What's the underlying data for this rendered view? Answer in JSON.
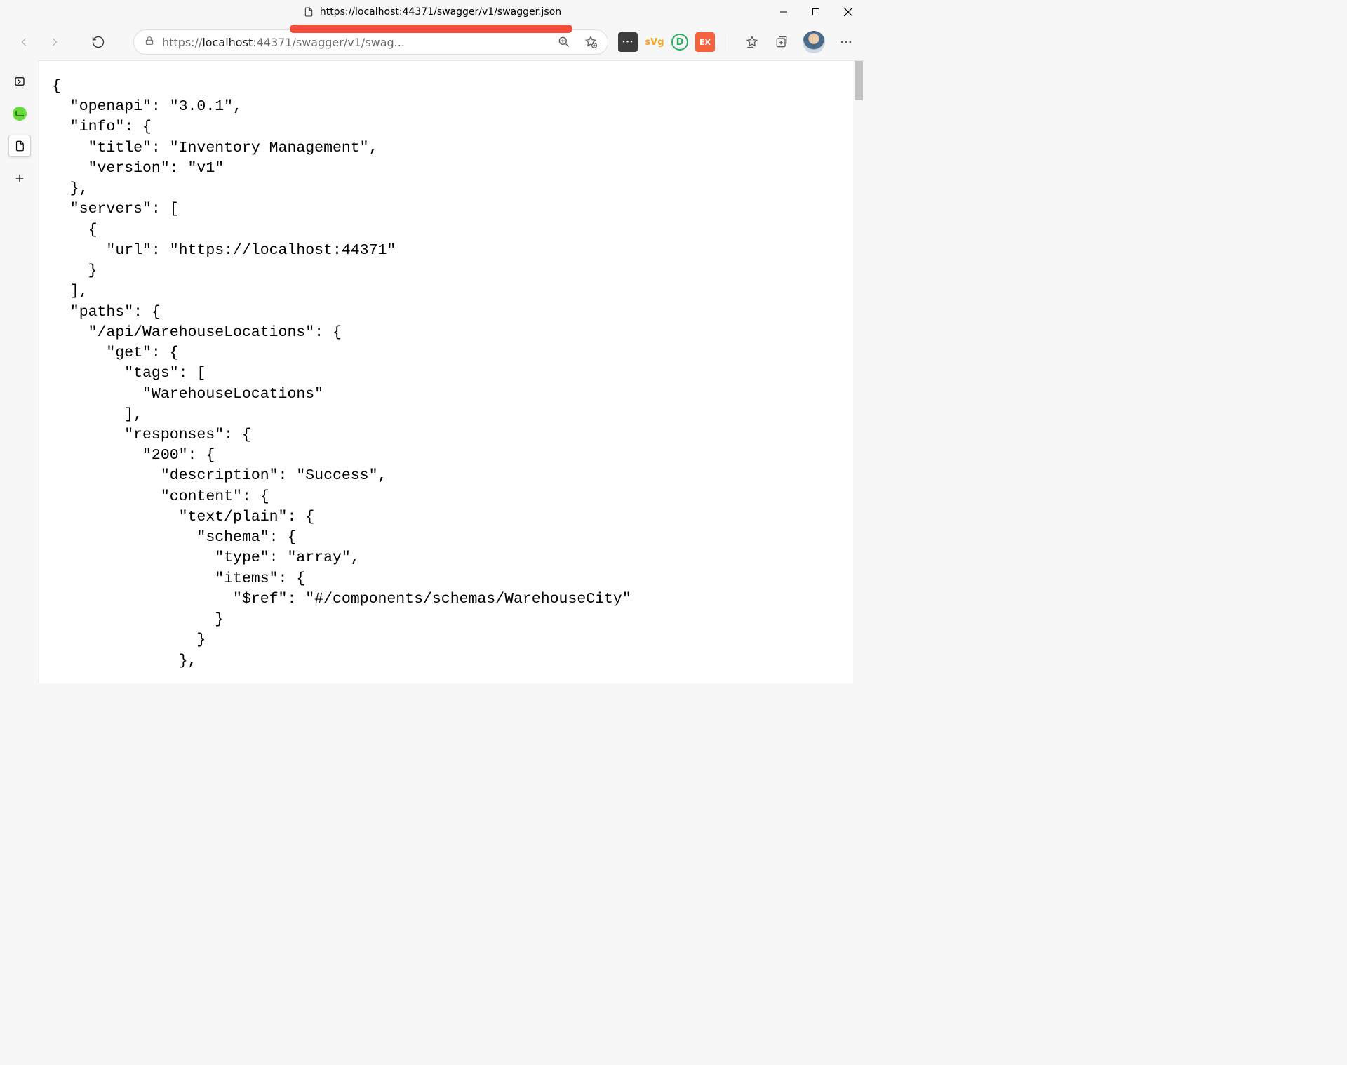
{
  "window": {
    "title_url": "https://localhost:44371/swagger/v1/swagger.json"
  },
  "address": {
    "prefix": "https://",
    "host": "localhost",
    "port": ":44371",
    "rest_truncated": "/swagger/v1/swag..."
  },
  "extensions": {
    "svg_label": "sVg",
    "d_label": "D",
    "ex_label": "EX"
  },
  "json_lines": [
    "{",
    "  \"openapi\": \"3.0.1\",",
    "  \"info\": {",
    "    \"title\": \"Inventory Management\",",
    "    \"version\": \"v1\"",
    "  },",
    "  \"servers\": [",
    "    {",
    "      \"url\": \"https://localhost:44371\"",
    "    }",
    "  ],",
    "  \"paths\": {",
    "    \"/api/WarehouseLocations\": {",
    "      \"get\": {",
    "        \"tags\": [",
    "          \"WarehouseLocations\"",
    "        ],",
    "        \"responses\": {",
    "          \"200\": {",
    "            \"description\": \"Success\",",
    "            \"content\": {",
    "              \"text/plain\": {",
    "                \"schema\": {",
    "                  \"type\": \"array\",",
    "                  \"items\": {",
    "                    \"$ref\": \"#/components/schemas/WarehouseCity\"",
    "                  }",
    "                }",
    "              },"
  ]
}
